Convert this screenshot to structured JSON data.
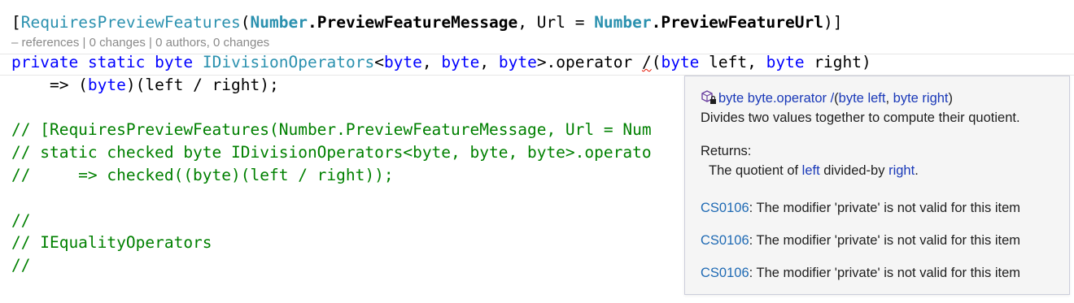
{
  "code": {
    "line1": {
      "open": "[",
      "attr": "RequiresPreviewFeatures",
      "paren_open": "(",
      "type1": "Number",
      "member1": ".PreviewFeatureMessage",
      "mid": ", Url = ",
      "type2": "Number",
      "member2": ".PreviewFeatureUrl",
      "close": ")]"
    },
    "codelens": "– references | 0 changes | 0 authors, 0 changes",
    "line2": {
      "kw1": "private",
      "kw2": "static",
      "kw3": "byte",
      "iface": "IDivisionOperators",
      "lt": "<",
      "g1": "byte",
      "comma1": ", ",
      "g2": "byte",
      "comma2": ", ",
      "g3": "byte",
      "gt_op": ">.operator ",
      "op": "/",
      "paren": "(",
      "p1type": "byte",
      "p1name": " left, ",
      "p2type": "byte",
      "p2name": " right)"
    },
    "line3": {
      "arrow": "    => (",
      "cast": "byte",
      "rest": ")(left / right);"
    },
    "comments": [
      "// [RequiresPreviewFeatures(Number.PreviewFeatureMessage, Url = Num",
      "// static checked byte IDivisionOperators<byte, byte, byte>.operato",
      "//     => checked((byte)(left / right));",
      "",
      "//",
      "// IEqualityOperators",
      "//"
    ]
  },
  "tooltip": {
    "icon": "method-protected-icon",
    "sig_type": "byte",
    "sig_name": " byte.operator /",
    "sig_paren": "(",
    "sig_p1type": "byte",
    "sig_p1name": " left",
    "sig_comma": ", ",
    "sig_p2type": "byte",
    "sig_p2name": " right",
    "sig_close": ")",
    "description": "Divides two values together to compute their quotient.",
    "returns_label": "Returns:",
    "returns_pre": "The quotient of ",
    "returns_left": "left",
    "returns_mid": " divided-by ",
    "returns_right": "right",
    "returns_end": ".",
    "errors": [
      {
        "code": "CS0106",
        "message": ": The modifier 'private' is not valid for this item"
      },
      {
        "code": "CS0106",
        "message": ": The modifier 'private' is not valid for this item"
      },
      {
        "code": "CS0106",
        "message": ": The modifier 'private' is not valid for this item"
      }
    ]
  },
  "colors": {
    "keyword": "#0000ff",
    "type": "#2b91af",
    "comment": "#008000",
    "error_squiggle": "#e51400",
    "tooltip_link": "#1f6ab4"
  }
}
